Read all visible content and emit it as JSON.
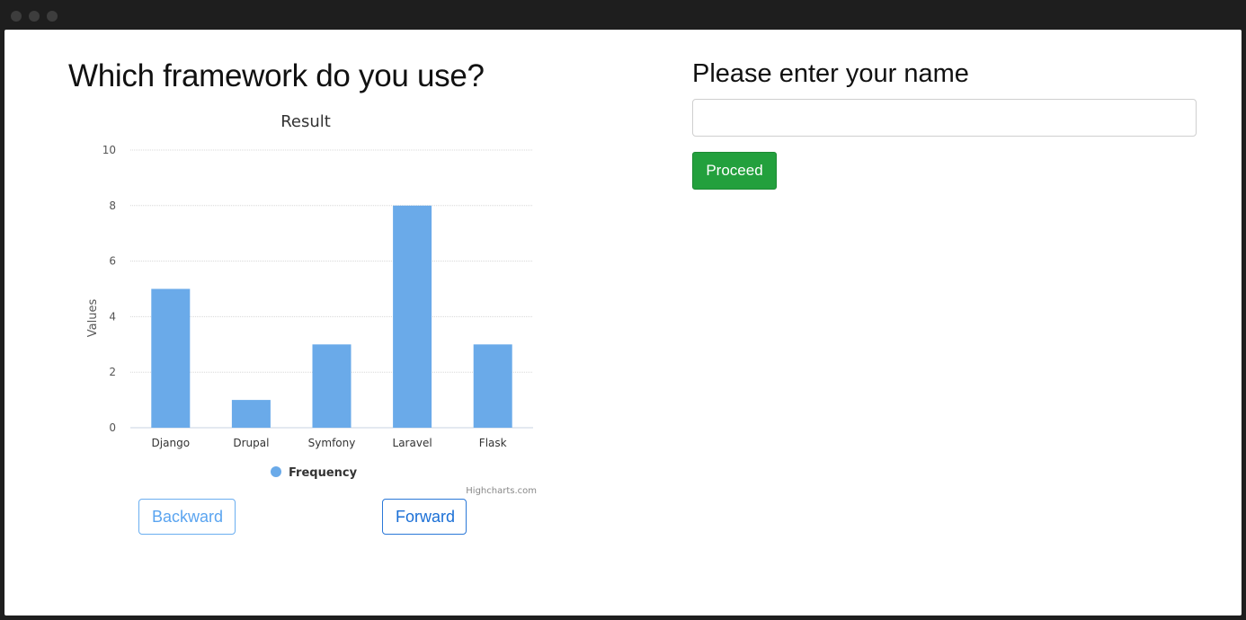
{
  "question": {
    "title": "Which framework do you use?"
  },
  "chart_data": {
    "type": "bar",
    "title": "Result",
    "ylabel": "Values",
    "xlabel": "",
    "categories": [
      "Django",
      "Drupal",
      "Symfony",
      "Laravel",
      "Flask"
    ],
    "series": [
      {
        "name": "Frequency",
        "values": [
          5,
          1,
          3,
          8,
          3
        ]
      }
    ],
    "ylim": [
      0,
      10
    ],
    "yticks": [
      0,
      2,
      4,
      6,
      8,
      10
    ],
    "grid": true,
    "legend_position": "bottom-center",
    "credit": "Highcharts.com",
    "colors": {
      "bar": "#6aaae9",
      "grid": "#d8d8d8",
      "axis": "#c9d3e0"
    }
  },
  "navigation": {
    "backward_label": "Backward",
    "forward_label": "Forward"
  },
  "name_form": {
    "title": "Please enter your name",
    "input_value": "",
    "input_placeholder": "",
    "proceed_label": "Proceed"
  },
  "colors": {
    "proceed_button": "#23a03d",
    "link_blue": "#1a6fd6",
    "window_chrome": "#1e1e1e"
  }
}
